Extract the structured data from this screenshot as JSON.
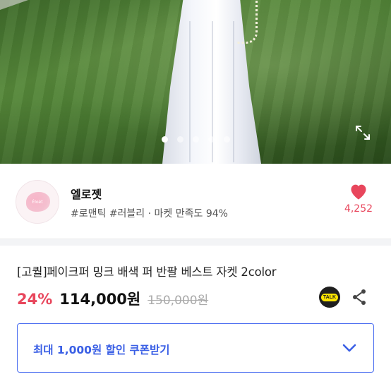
{
  "gallery": {
    "dot_count": 5,
    "active_index": 0
  },
  "seller": {
    "name": "엘로젯",
    "avatar_text": "Éloét",
    "tags_satisfaction": "#로맨틱 #러블리 · 마켓 만족도 94%",
    "like_count": "4,252"
  },
  "product": {
    "title": "[고퀄]페이크퍼 밍크 배색 퍼 반팔 베스트 자켓 2color",
    "discount": "24%",
    "price": "114,000원",
    "original_price": "150,000원"
  },
  "talk_badge": "TALK",
  "coupon": {
    "label": "최대 1,000원 할인 쿠폰받기"
  },
  "colors": {
    "accent_red": "#e8465c",
    "accent_blue": "#3a5fe5"
  },
  "icons": {
    "expand": "expand-icon",
    "heart": "heart-icon",
    "talk": "kakaotalk-icon",
    "share": "share-icon",
    "chevron": "chevron-down-icon"
  }
}
